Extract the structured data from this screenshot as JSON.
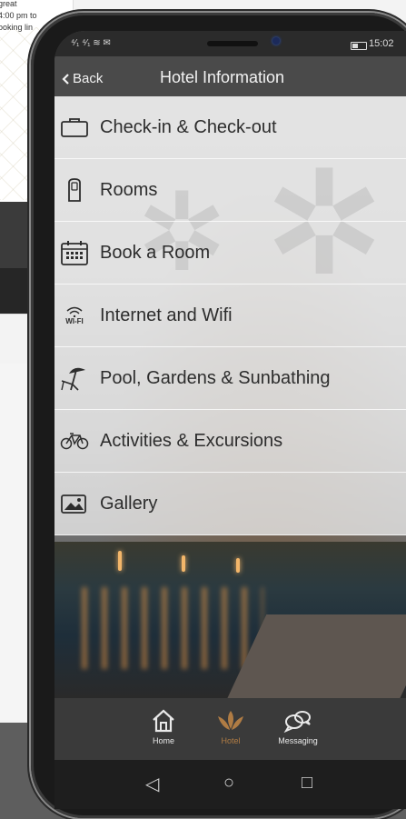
{
  "background_card": {
    "text_lines": [
      "great",
      "4:00 pm to",
      "ooking lin"
    ]
  },
  "status_bar": {
    "signal": "⁴⁄₁ ⁴⁄₁ ≋ ✉",
    "time": "15:02"
  },
  "header": {
    "back_label": "Back",
    "title": "Hotel Information"
  },
  "menu": {
    "items": [
      {
        "label": "Check-in & Check-out",
        "icon": "briefcase-icon"
      },
      {
        "label": "Rooms",
        "icon": "door-icon"
      },
      {
        "label": "Book a Room",
        "icon": "calendar-icon"
      },
      {
        "label": "Internet and Wifi",
        "icon": "wifi-icon",
        "icon_text": "WI-FI"
      },
      {
        "label": "Pool, Gardens & Sunbathing",
        "icon": "beach-umbrella-icon"
      },
      {
        "label": "Activities & Excursions",
        "icon": "bicycle-icon"
      },
      {
        "label": "Gallery",
        "icon": "image-gallery-icon"
      }
    ]
  },
  "tabs": [
    {
      "label": "Home",
      "icon": "home-icon",
      "active": false
    },
    {
      "label": "Hotel",
      "icon": "lotus-icon",
      "active": true
    },
    {
      "label": "Messaging",
      "icon": "chat-icon",
      "active": false
    }
  ],
  "system_nav": {
    "back": "◁",
    "home": "○",
    "recent": "□"
  },
  "colors": {
    "accent": "#b07c44",
    "header_bg": "#4a4a4a",
    "tabbar_bg": "#3a3a3a"
  }
}
